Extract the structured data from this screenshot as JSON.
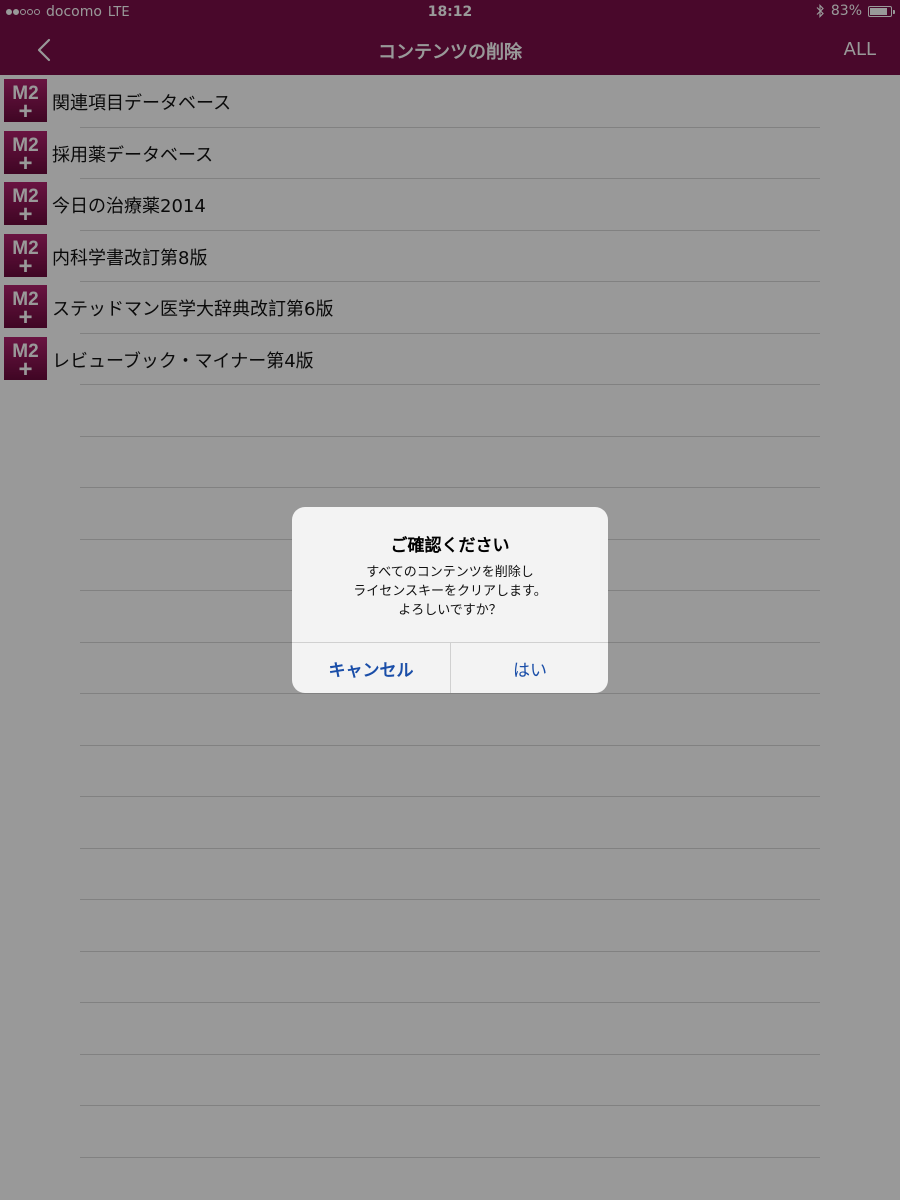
{
  "status_bar": {
    "carrier": "docomo",
    "network": "LTE",
    "time": "18:12",
    "battery": "83%",
    "signal_bars_filled": 2,
    "signal_bars_total": 5,
    "bluetooth_icon": "bluetooth-icon"
  },
  "nav": {
    "back_icon": "chevron-left-icon",
    "title": "コンテンツの削除",
    "all_label": "ALL"
  },
  "content_items": [
    {
      "label": "関連項目データベース",
      "icon": "m2plus-app-icon"
    },
    {
      "label": "採用薬データベース",
      "icon": "m2plus-app-icon"
    },
    {
      "label": "今日の治療薬2014",
      "icon": "m2plus-app-icon"
    },
    {
      "label": "内科学書改訂第8版",
      "icon": "m2plus-app-icon"
    },
    {
      "label": "ステッドマン医学大辞典改訂第6版",
      "icon": "m2plus-app-icon"
    },
    {
      "label": "レビューブック・マイナー第4版",
      "icon": "m2plus-app-icon"
    }
  ],
  "icon_text": {
    "top": "M2",
    "bottom": "+"
  },
  "alert": {
    "title": "ご確認ください",
    "message_lines": [
      "すべてのコンテンツを削除し",
      "ライセンスキーをクリアします。",
      "よろしいですか？"
    ],
    "cancel_label": "キャンセル",
    "ok_label": "はい"
  },
  "colors": {
    "brand": "#7a0e48",
    "alert_button": "#1a4ea8",
    "alert_background": "#f3f3f3"
  }
}
